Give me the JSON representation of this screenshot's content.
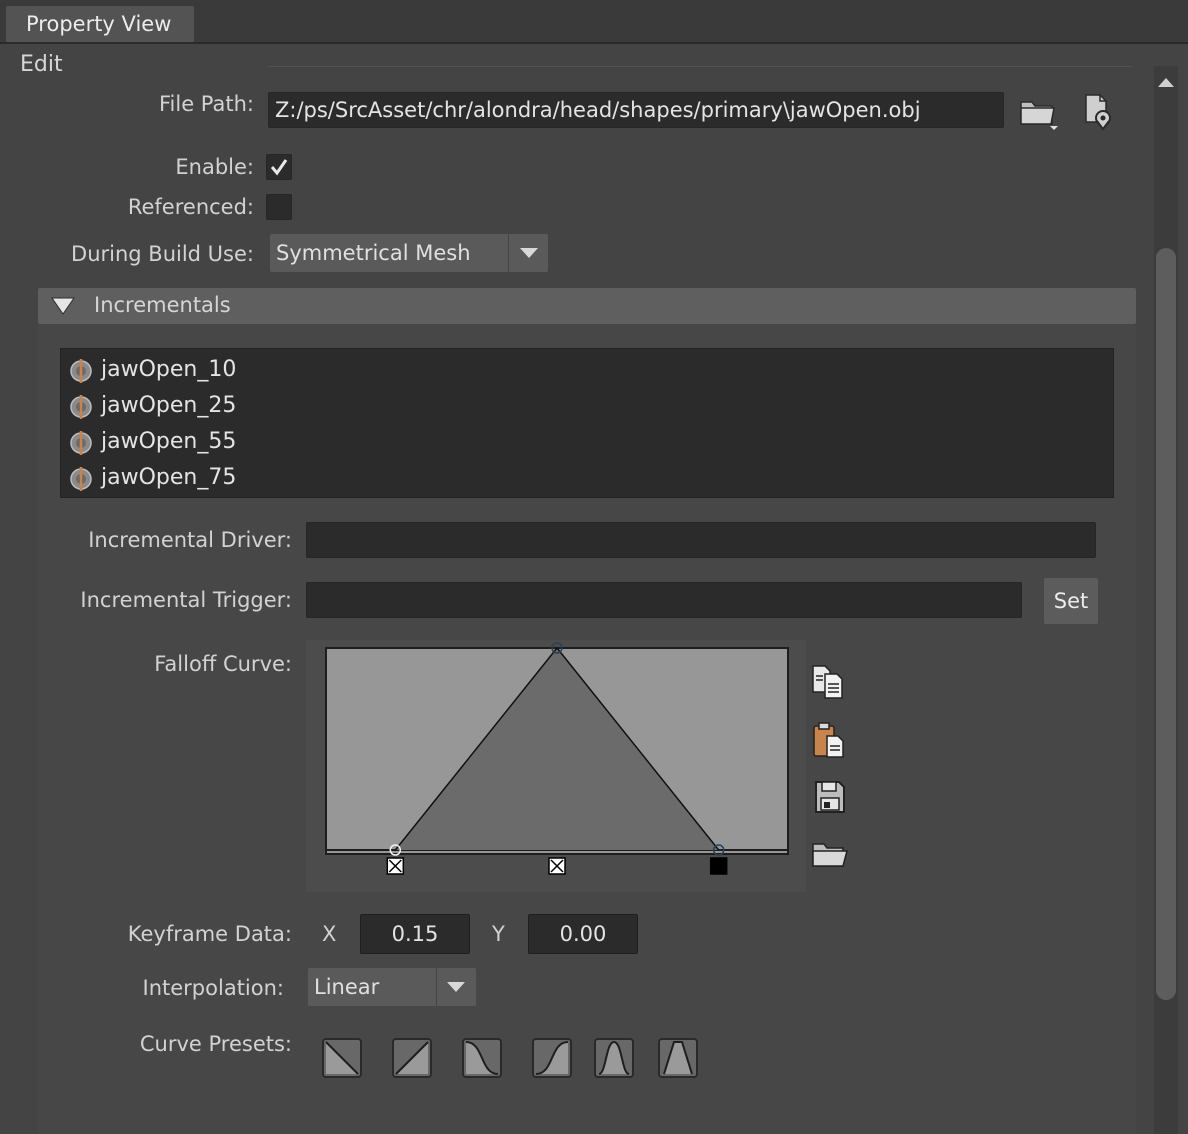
{
  "tab": {
    "title": "Property View"
  },
  "section": {
    "edit": "Edit"
  },
  "file_path": {
    "label": "File Path:",
    "value": "Z:/ps/SrcAsset/chr/alondra/head/shapes/primary\\jawOpen.obj"
  },
  "enable": {
    "label": "Enable:",
    "checked": true
  },
  "referenced": {
    "label": "Referenced:",
    "checked": false
  },
  "during_build_use": {
    "label": "During Build Use:",
    "value": "Symmetrical Mesh"
  },
  "incrementals": {
    "title": "Incrementals",
    "items": [
      {
        "label": "jawOpen_10"
      },
      {
        "label": "jawOpen_25"
      },
      {
        "label": "jawOpen_55"
      },
      {
        "label": "jawOpen_75"
      }
    ],
    "driver_label": "Incremental Driver:",
    "driver_value": "",
    "trigger_label": "Incremental Trigger:",
    "trigger_value": "",
    "set_button": "Set",
    "falloff_label": "Falloff Curve:",
    "falloff_keys": [
      {
        "x": 0.15,
        "y": 0.0
      },
      {
        "x": 0.5,
        "y": 1.0
      },
      {
        "x": 0.85,
        "y": 0.0
      }
    ],
    "keyframe_label": "Keyframe Data:",
    "x_label": "X",
    "x_value": "0.15",
    "y_label": "Y",
    "y_value": "0.00",
    "interpolation_label": "Interpolation:",
    "interpolation_value": "Linear",
    "presets_label": "Curve Presets:"
  },
  "icons": {
    "browse": "folder-icon",
    "locate": "file-locate-icon",
    "copy": "copy-icon",
    "paste": "paste-icon",
    "save": "save-icon",
    "load": "open-folder-icon"
  },
  "colors": {
    "background": "#444444",
    "field": "#2b2b2b",
    "curve_bg": "#979797",
    "curve_fill": "#6b6b6b",
    "accent_orange": "#c8844a"
  }
}
